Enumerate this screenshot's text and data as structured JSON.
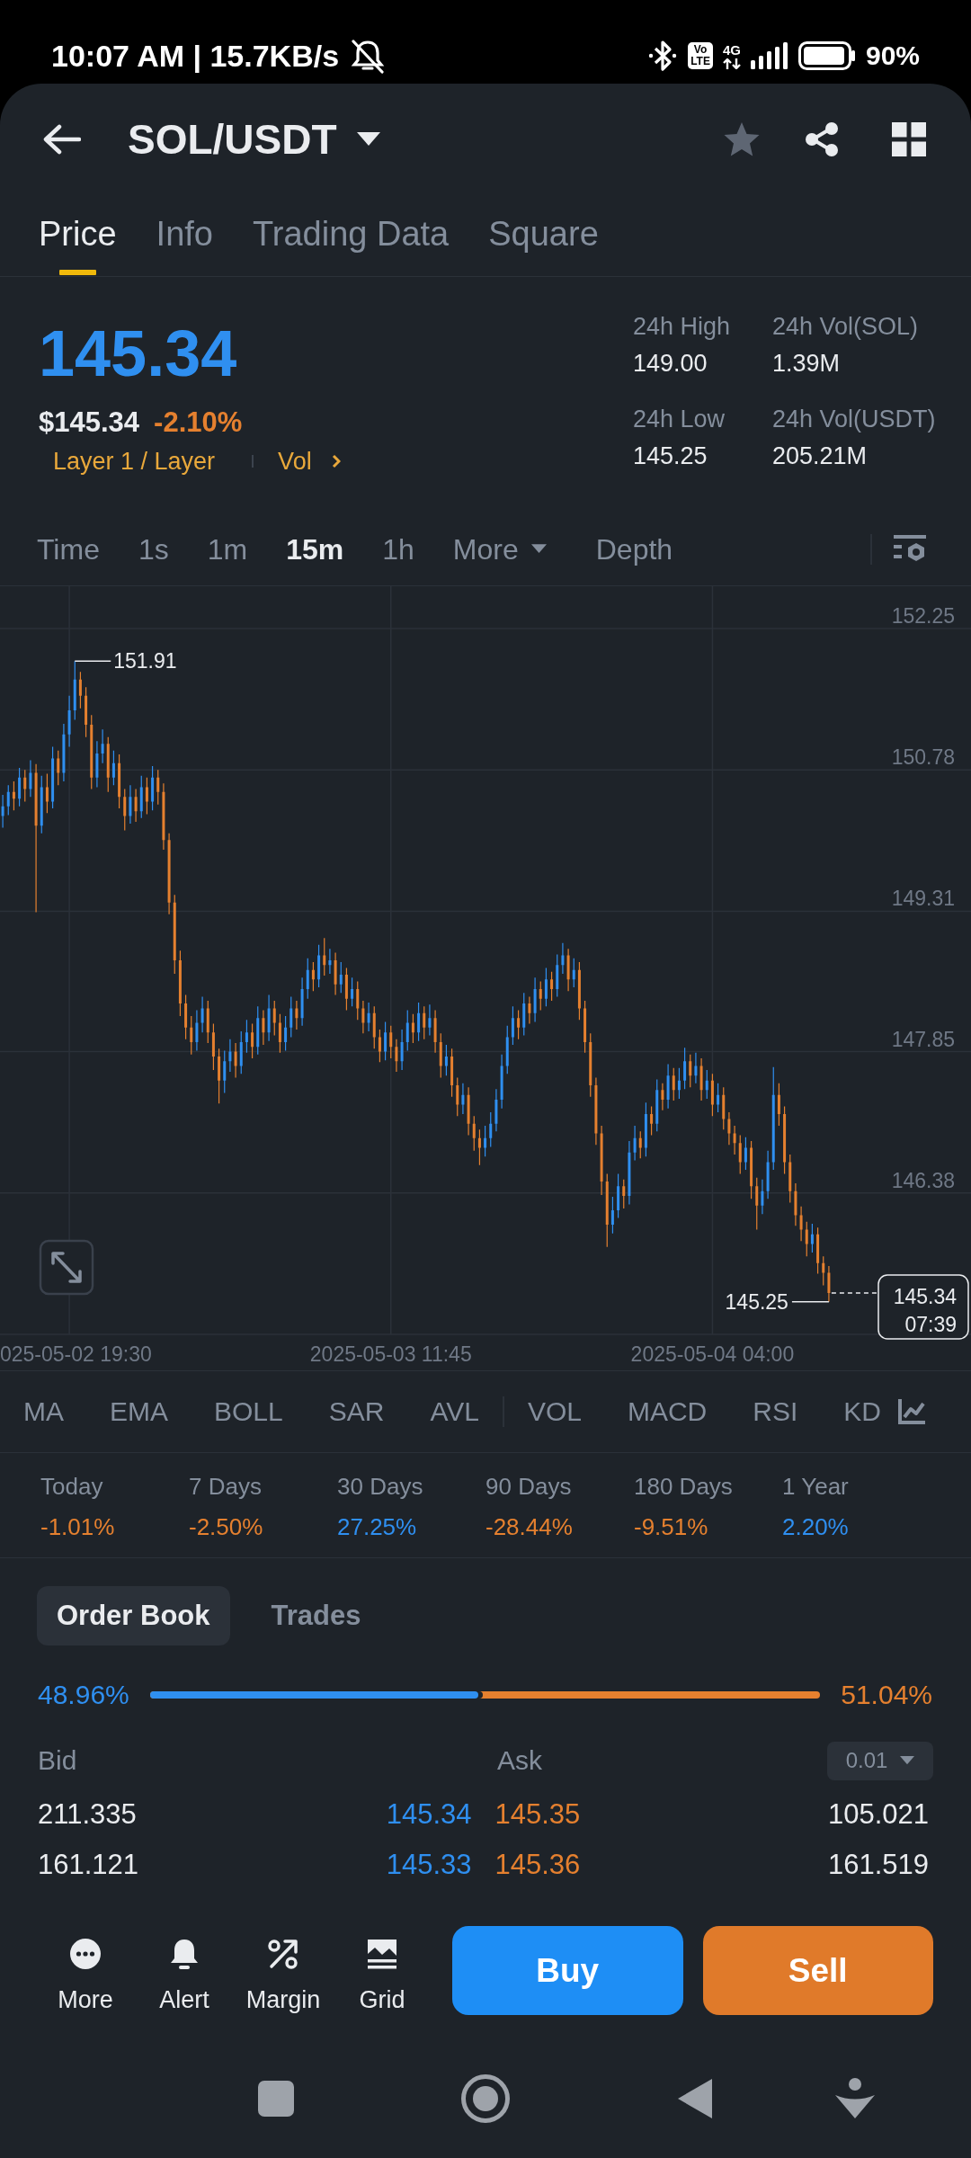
{
  "status_bar": {
    "time": "10:07 AM | 15.7KB/s",
    "volte": [
      "Vo",
      "LTE"
    ],
    "network": "4G",
    "battery": "90%"
  },
  "header": {
    "pair": "SOL/USDT",
    "favorite": false
  },
  "tabs": [
    {
      "label": "Price",
      "selected": true
    },
    {
      "label": "Info",
      "selected": false
    },
    {
      "label": "Trading Data",
      "selected": false
    },
    {
      "label": "Square",
      "selected": false
    }
  ],
  "ticker": {
    "last_price": "145.34",
    "fiat_price": "$145.34",
    "change": "-2.10%",
    "sector": "Layer 1 / Layer",
    "volume_link": "Vol",
    "stats": [
      {
        "label": "24h High",
        "value": "149.00"
      },
      {
        "label": "24h Vol(SOL)",
        "value": "1.39M"
      },
      {
        "label": "24h Low",
        "value": "145.25"
      },
      {
        "label": "24h Vol(USDT)",
        "value": "205.21M"
      }
    ]
  },
  "intervals": [
    {
      "label": "Time",
      "kind": "interval",
      "selected": false
    },
    {
      "label": "1s",
      "kind": "interval",
      "selected": false
    },
    {
      "label": "1m",
      "kind": "interval",
      "selected": false
    },
    {
      "label": "15m",
      "kind": "interval",
      "selected": true
    },
    {
      "label": "1h",
      "kind": "interval",
      "selected": false
    },
    {
      "label": "More",
      "kind": "menu",
      "selected": false
    },
    {
      "label": "Depth",
      "kind": "view",
      "selected": false
    }
  ],
  "chart": {
    "chart_data": {
      "type": "candlestick",
      "grid": true,
      "categories": [
        null,
        null,
        null,
        null,
        null,
        null,
        null,
        null,
        null,
        null,
        null,
        null,
        "025-05-02 19:30",
        null,
        null,
        null,
        null,
        null,
        null,
        null,
        null,
        null,
        null,
        null,
        null,
        null,
        null,
        null,
        null,
        null,
        null,
        null,
        null,
        null,
        null,
        null,
        null,
        null,
        null,
        null,
        null,
        null,
        null,
        null,
        null,
        null,
        null,
        null,
        null,
        null,
        null,
        null,
        null,
        null,
        null,
        null,
        null,
        null,
        null,
        null,
        null,
        null,
        null,
        null,
        null,
        null,
        null,
        null,
        null,
        null,
        "2025-05-03 11:45",
        null,
        null,
        null,
        null,
        null,
        null,
        null,
        null,
        null,
        null,
        null,
        null,
        null,
        null,
        null,
        null,
        null,
        null,
        null,
        null,
        null,
        null,
        null,
        null,
        null,
        null,
        null,
        null,
        null,
        null,
        null,
        null,
        null,
        null,
        null,
        null,
        null,
        null,
        null,
        null,
        null,
        null,
        null,
        null,
        null,
        null,
        null,
        null,
        null,
        null,
        null,
        null,
        null,
        null,
        null,
        null,
        null,
        "2025-05-04 04:00",
        null,
        null,
        null,
        null,
        null,
        null,
        null,
        null,
        null,
        null,
        null,
        null,
        null,
        null,
        null,
        null,
        null,
        null,
        null,
        null,
        null
      ],
      "ohlc": [
        [
          150.3,
          150.52,
          150.18,
          150.4
        ],
        [
          150.4,
          150.62,
          150.31,
          150.55
        ],
        [
          150.55,
          150.66,
          150.36,
          150.48
        ],
        [
          150.48,
          150.8,
          150.4,
          150.7
        ],
        [
          150.7,
          150.78,
          150.45,
          150.58
        ],
        [
          150.58,
          150.88,
          150.5,
          150.75
        ],
        [
          150.75,
          150.84,
          149.3,
          150.2
        ],
        [
          150.2,
          150.72,
          150.12,
          150.6
        ],
        [
          150.6,
          150.74,
          150.33,
          150.45
        ],
        [
          150.45,
          151.02,
          150.38,
          150.9
        ],
        [
          150.9,
          150.98,
          150.62,
          150.75
        ],
        [
          150.75,
          151.26,
          150.66,
          151.15
        ],
        [
          151.15,
          151.55,
          151.02,
          151.4
        ],
        [
          151.4,
          151.91,
          151.3,
          151.72
        ],
        [
          151.72,
          151.8,
          151.42,
          151.55
        ],
        [
          151.55,
          151.64,
          151.12,
          151.25
        ],
        [
          151.25,
          151.35,
          150.58,
          150.7
        ],
        [
          150.7,
          151.08,
          150.6,
          150.95
        ],
        [
          150.95,
          151.2,
          150.85,
          151.05
        ],
        [
          151.05,
          151.12,
          150.55,
          150.7
        ],
        [
          150.7,
          150.98,
          150.62,
          150.85
        ],
        [
          150.85,
          150.94,
          150.38,
          150.5
        ],
        [
          150.5,
          150.58,
          150.15,
          150.3
        ],
        [
          150.3,
          150.62,
          150.22,
          150.5
        ],
        [
          150.5,
          150.58,
          150.24,
          150.35
        ],
        [
          150.35,
          150.72,
          150.28,
          150.6
        ],
        [
          150.6,
          150.7,
          150.32,
          150.45
        ],
        [
          150.45,
          150.82,
          150.36,
          150.7
        ],
        [
          150.7,
          150.78,
          150.42,
          150.55
        ],
        [
          150.55,
          150.64,
          149.95,
          150.05
        ],
        [
          150.05,
          150.12,
          149.28,
          149.4
        ],
        [
          149.4,
          149.48,
          148.66,
          148.8
        ],
        [
          148.8,
          148.9,
          148.22,
          148.35
        ],
        [
          148.35,
          148.44,
          147.98,
          148.1
        ],
        [
          148.1,
          148.22,
          147.82,
          147.95
        ],
        [
          147.95,
          148.28,
          147.86,
          148.15
        ],
        [
          148.15,
          148.42,
          148.05,
          148.3
        ],
        [
          148.3,
          148.38,
          147.94,
          148.05
        ],
        [
          148.05,
          148.14,
          147.66,
          147.8
        ],
        [
          147.8,
          147.88,
          147.31,
          147.55
        ],
        [
          147.55,
          147.86,
          147.42,
          147.75
        ],
        [
          147.75,
          147.98,
          147.64,
          147.85
        ],
        [
          147.85,
          147.94,
          147.58,
          147.7
        ],
        [
          147.7,
          148.06,
          147.62,
          147.95
        ],
        [
          147.95,
          148.18,
          147.84,
          148.05
        ],
        [
          148.05,
          148.14,
          147.78,
          147.9
        ],
        [
          147.9,
          148.32,
          147.82,
          148.2
        ],
        [
          148.2,
          148.28,
          147.92,
          148.05
        ],
        [
          148.05,
          148.44,
          147.96,
          148.3
        ],
        [
          148.3,
          148.38,
          148.02,
          148.15
        ],
        [
          148.15,
          148.24,
          147.84,
          147.95
        ],
        [
          147.95,
          148.22,
          147.86,
          148.1
        ],
        [
          148.1,
          148.42,
          148.0,
          148.3
        ],
        [
          148.3,
          148.38,
          148.08,
          148.2
        ],
        [
          148.2,
          148.62,
          148.12,
          148.5
        ],
        [
          148.5,
          148.82,
          148.4,
          148.7
        ],
        [
          148.7,
          148.78,
          148.48,
          148.6
        ],
        [
          148.6,
          148.96,
          148.52,
          148.85
        ],
        [
          148.85,
          149.03,
          148.64,
          148.75
        ],
        [
          148.75,
          148.92,
          148.66,
          148.8
        ],
        [
          148.8,
          148.88,
          148.44,
          148.55
        ],
        [
          148.55,
          148.78,
          148.46,
          148.65
        ],
        [
          148.65,
          148.72,
          148.28,
          148.4
        ],
        [
          148.4,
          148.62,
          148.32,
          148.5
        ],
        [
          148.5,
          148.58,
          148.18,
          148.3
        ],
        [
          148.3,
          148.38,
          148.04,
          148.15
        ],
        [
          148.15,
          148.36,
          148.06,
          148.25
        ],
        [
          148.25,
          148.32,
          147.88,
          148.0
        ],
        [
          148.0,
          148.08,
          147.74,
          147.85
        ],
        [
          147.85,
          148.16,
          147.76,
          148.05
        ],
        [
          148.05,
          148.12,
          147.78,
          147.9
        ],
        [
          147.9,
          147.98,
          147.64,
          147.75
        ],
        [
          147.75,
          148.08,
          147.66,
          147.95
        ],
        [
          147.95,
          148.28,
          147.86,
          148.15
        ],
        [
          148.15,
          148.24,
          147.94,
          148.05
        ],
        [
          148.05,
          148.36,
          147.96,
          148.25
        ],
        [
          148.25,
          148.32,
          147.98,
          148.1
        ],
        [
          148.1,
          148.34,
          148.02,
          148.2
        ],
        [
          148.2,
          148.28,
          147.84,
          147.95
        ],
        [
          147.95,
          148.04,
          147.58,
          147.7
        ],
        [
          147.7,
          147.92,
          147.6,
          147.8
        ],
        [
          147.8,
          147.88,
          147.38,
          147.5
        ],
        [
          147.5,
          147.58,
          147.18,
          147.3
        ],
        [
          147.3,
          147.52,
          147.2,
          147.4
        ],
        [
          147.4,
          147.48,
          146.98,
          147.1
        ],
        [
          147.1,
          147.18,
          146.82,
          146.95
        ],
        [
          146.95,
          147.04,
          146.67,
          146.85
        ],
        [
          146.85,
          147.08,
          146.76,
          146.95
        ],
        [
          146.95,
          147.22,
          146.86,
          147.1
        ],
        [
          147.1,
          147.46,
          147.02,
          147.35
        ],
        [
          147.35,
          147.82,
          147.26,
          147.7
        ],
        [
          147.7,
          148.12,
          147.62,
          148.0
        ],
        [
          148.0,
          148.32,
          147.92,
          148.2
        ],
        [
          148.2,
          148.28,
          147.98,
          148.1
        ],
        [
          148.1,
          148.46,
          148.02,
          148.35
        ],
        [
          148.35,
          148.42,
          148.14,
          148.25
        ],
        [
          148.25,
          148.62,
          148.16,
          148.5
        ],
        [
          148.5,
          148.58,
          148.28,
          148.4
        ],
        [
          148.4,
          148.72,
          148.32,
          148.6
        ],
        [
          148.6,
          148.68,
          148.38,
          148.5
        ],
        [
          148.5,
          148.86,
          148.42,
          148.75
        ],
        [
          148.75,
          148.98,
          148.66,
          148.85
        ],
        [
          148.85,
          148.92,
          148.48,
          148.6
        ],
        [
          148.6,
          148.82,
          148.52,
          148.7
        ],
        [
          148.7,
          148.78,
          148.18,
          148.3
        ],
        [
          148.3,
          148.38,
          147.84,
          147.95
        ],
        [
          147.95,
          148.04,
          147.38,
          147.5
        ],
        [
          147.5,
          147.58,
          146.88,
          147.0
        ],
        [
          147.0,
          147.08,
          146.36,
          146.5
        ],
        [
          146.5,
          146.58,
          145.82,
          146.05
        ],
        [
          146.05,
          146.34,
          145.96,
          146.2
        ],
        [
          146.2,
          146.58,
          146.12,
          146.45
        ],
        [
          146.45,
          146.52,
          146.22,
          146.35
        ],
        [
          146.35,
          146.92,
          146.26,
          146.8
        ],
        [
          146.8,
          147.08,
          146.72,
          146.95
        ],
        [
          146.95,
          147.02,
          146.74,
          146.85
        ],
        [
          146.85,
          147.32,
          146.76,
          147.2
        ],
        [
          147.2,
          147.28,
          146.98,
          147.1
        ],
        [
          147.1,
          147.56,
          147.02,
          147.45
        ],
        [
          147.45,
          147.52,
          147.24,
          147.35
        ],
        [
          147.35,
          147.72,
          147.26,
          147.6
        ],
        [
          147.6,
          147.68,
          147.34,
          147.45
        ],
        [
          147.45,
          147.68,
          147.36,
          147.55
        ],
        [
          147.55,
          147.89,
          147.46,
          147.75
        ],
        [
          147.75,
          147.82,
          147.48,
          147.6
        ],
        [
          147.6,
          147.84,
          147.52,
          147.7
        ],
        [
          147.7,
          147.78,
          147.34,
          147.45
        ],
        [
          147.45,
          147.66,
          147.36,
          147.55
        ],
        [
          147.55,
          147.62,
          147.18,
          147.3
        ],
        [
          147.3,
          147.52,
          147.22,
          147.4
        ],
        [
          147.4,
          147.48,
          147.04,
          147.15
        ],
        [
          147.15,
          147.22,
          146.88,
          147.0
        ],
        [
          147.0,
          147.08,
          146.78,
          146.9
        ],
        [
          146.9,
          146.98,
          146.58,
          146.7
        ],
        [
          146.7,
          146.96,
          146.62,
          146.85
        ],
        [
          146.85,
          146.92,
          146.32,
          146.45
        ],
        [
          146.45,
          146.54,
          146.0,
          146.25
        ],
        [
          146.25,
          146.52,
          146.16,
          146.4
        ],
        [
          146.4,
          146.82,
          146.32,
          146.7
        ],
        [
          146.7,
          147.69,
          146.62,
          147.4
        ],
        [
          147.4,
          147.52,
          147.08,
          147.2
        ],
        [
          147.2,
          147.28,
          146.58,
          146.7
        ],
        [
          146.7,
          146.78,
          146.28,
          146.4
        ],
        [
          146.4,
          146.48,
          146.04,
          146.15
        ],
        [
          146.15,
          146.24,
          145.88,
          146.0
        ],
        [
          146.0,
          146.08,
          145.72,
          145.85
        ],
        [
          145.85,
          146.06,
          145.76,
          145.95
        ],
        [
          145.95,
          146.02,
          145.54,
          145.65
        ],
        [
          145.65,
          145.72,
          145.42,
          145.55
        ],
        [
          145.55,
          145.62,
          145.25,
          145.34
        ]
      ],
      "ylim": [
        144.91,
        152.25
      ],
      "yticks": [
        {
          "value": 152.25,
          "label": "152.25"
        },
        {
          "value": 150.78,
          "label": "150.78"
        },
        {
          "value": 149.31,
          "label": "149.31"
        },
        {
          "value": 147.85,
          "label": "147.85"
        },
        {
          "value": 146.38,
          "label": "146.38"
        }
      ]
    },
    "high": "151.91",
    "low": "145.25",
    "last_price": "145.34",
    "countdown": "07:39"
  },
  "indicators": {
    "main": [
      "MA",
      "EMA",
      "BOLL",
      "SAR",
      "AVL"
    ],
    "sub": [
      "VOL",
      "MACD",
      "RSI",
      "KD"
    ]
  },
  "performance": [
    {
      "period": "Today",
      "change": "-1.01%",
      "color": "#e5802f"
    },
    {
      "period": "7 Days",
      "change": "-2.50%",
      "color": "#e5802f"
    },
    {
      "period": "30 Days",
      "change": "27.25%",
      "color": "#2f8ff0"
    },
    {
      "period": "90 Days",
      "change": "-28.44%",
      "color": "#e5802f"
    },
    {
      "period": "180 Days",
      "change": "-9.51%",
      "color": "#e5802f"
    },
    {
      "period": "1 Year",
      "change": "2.20%",
      "color": "#2f8ff0"
    }
  ],
  "order_book": {
    "tabs": [
      {
        "label": "Order Book",
        "selected": true
      },
      {
        "label": "Trades",
        "selected": false
      }
    ],
    "bid_ratio": "48.96%",
    "ask_ratio": "51.04%",
    "level": 0.4896,
    "bid_header": "Bid",
    "ask_header": "Ask",
    "precision": "0.01",
    "rows": [
      {
        "bid_amount": "211.335",
        "bid_price": "145.34",
        "ask_price": "145.35",
        "ask_amount": "105.021"
      },
      {
        "bid_amount": "161.121",
        "bid_price": "145.33",
        "ask_price": "145.36",
        "ask_amount": "161.519"
      }
    ]
  },
  "actions": [
    {
      "label": "More",
      "kind": "more"
    },
    {
      "label": "Alert",
      "kind": "alert"
    },
    {
      "label": "Margin",
      "kind": "margin"
    },
    {
      "label": "Grid",
      "kind": "grid"
    }
  ],
  "trade_buttons": {
    "buy": "Buy",
    "sell": "Sell"
  }
}
